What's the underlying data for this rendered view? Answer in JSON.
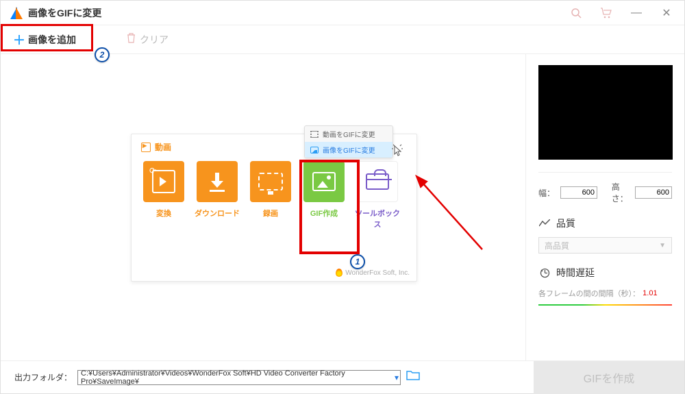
{
  "window": {
    "title": "画像をGIFに変更"
  },
  "toolbar": {
    "add_label": "画像を追加",
    "clear_label": "クリア"
  },
  "panel": {
    "section": "動画",
    "tiles": {
      "convert": "変換",
      "download": "ダウンロード",
      "record": "録画",
      "gif": "GIF作成",
      "toolbox": "ツールボックス"
    },
    "popup": {
      "video_to_gif": "動画をGIFに変更",
      "image_to_gif": "画像をGIFに変更"
    },
    "credit": "WonderFox Soft, Inc."
  },
  "side": {
    "width_label": "幅：",
    "width_value": "600",
    "height_label": "高さ：",
    "height_value": "600",
    "quality_head": "品質",
    "quality_value": "高品質",
    "delay_head": "時間遅延",
    "delay_text": "各フレームの間の間隔（秒）：",
    "delay_value": "1.01"
  },
  "bottom": {
    "out_label": "出力フォルダ：",
    "out_path": "C:¥Users¥Administrator¥Videos¥WonderFox Soft¥HD Video Converter Factory Pro¥SaveImage¥",
    "make_gif": "GIFを作成"
  },
  "badges": {
    "one": "1",
    "two": "2"
  }
}
